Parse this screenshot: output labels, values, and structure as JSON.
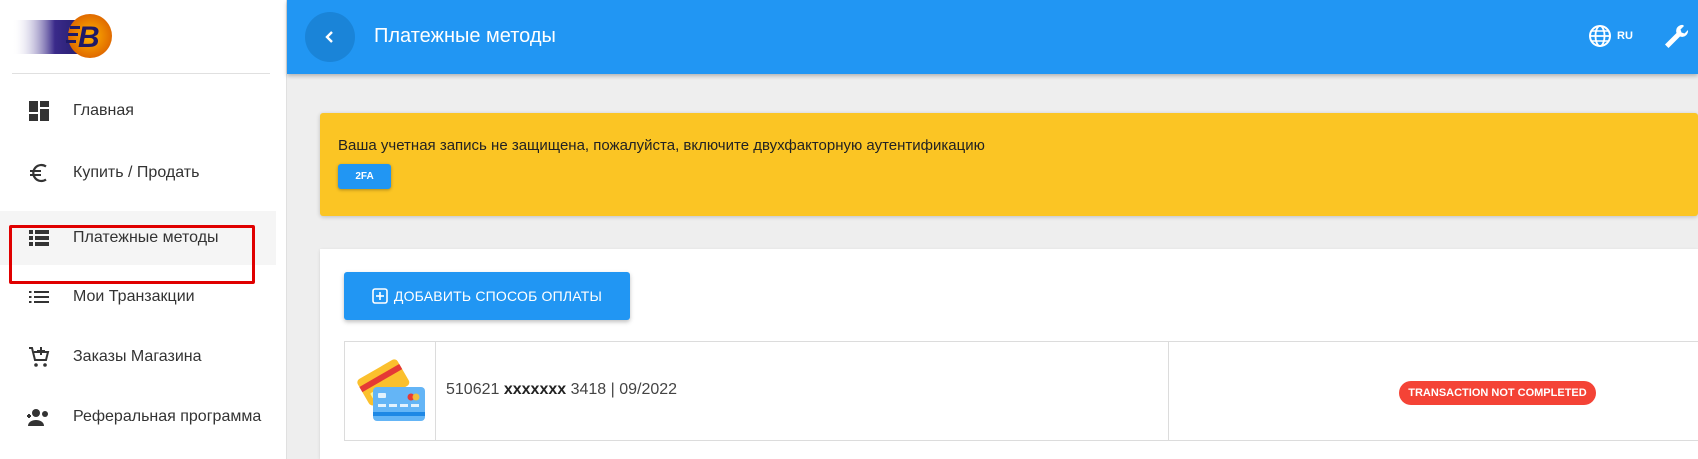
{
  "app": {
    "brand_colors": {
      "primary": "#2196f3",
      "warning": "#fbc524",
      "danger": "#f44336",
      "highlight": "#e00000"
    }
  },
  "sidebar": {
    "items": [
      {
        "label": "Главная",
        "icon": "dashboard-icon"
      },
      {
        "label": "Купить / Продать",
        "icon": "euro-icon"
      },
      {
        "label": "Платежные методы",
        "icon": "list-icon",
        "active": true
      },
      {
        "label": "Мои Транзакции",
        "icon": "list-lines-icon"
      },
      {
        "label": "Заказы Магазина",
        "icon": "cart-add-icon"
      },
      {
        "label": "Реферальная программа",
        "icon": "people-icon"
      }
    ]
  },
  "header": {
    "title": "Платежные методы",
    "language": "RU"
  },
  "warning": {
    "text": "Ваша учетная запись не защищена, пожалуйста, включите двухфакторную аутентификацию",
    "button_label": "2FA"
  },
  "payment_methods": {
    "add_button_label": "ДОБАВИТЬ СПОСОБ ОПЛАТЫ",
    "rows": [
      {
        "card_prefix": "510621",
        "card_masked": "xxxxxxx",
        "card_suffix": "3418 | 09/2022",
        "status": "TRANSACTION NOT COMPLETED"
      }
    ]
  }
}
